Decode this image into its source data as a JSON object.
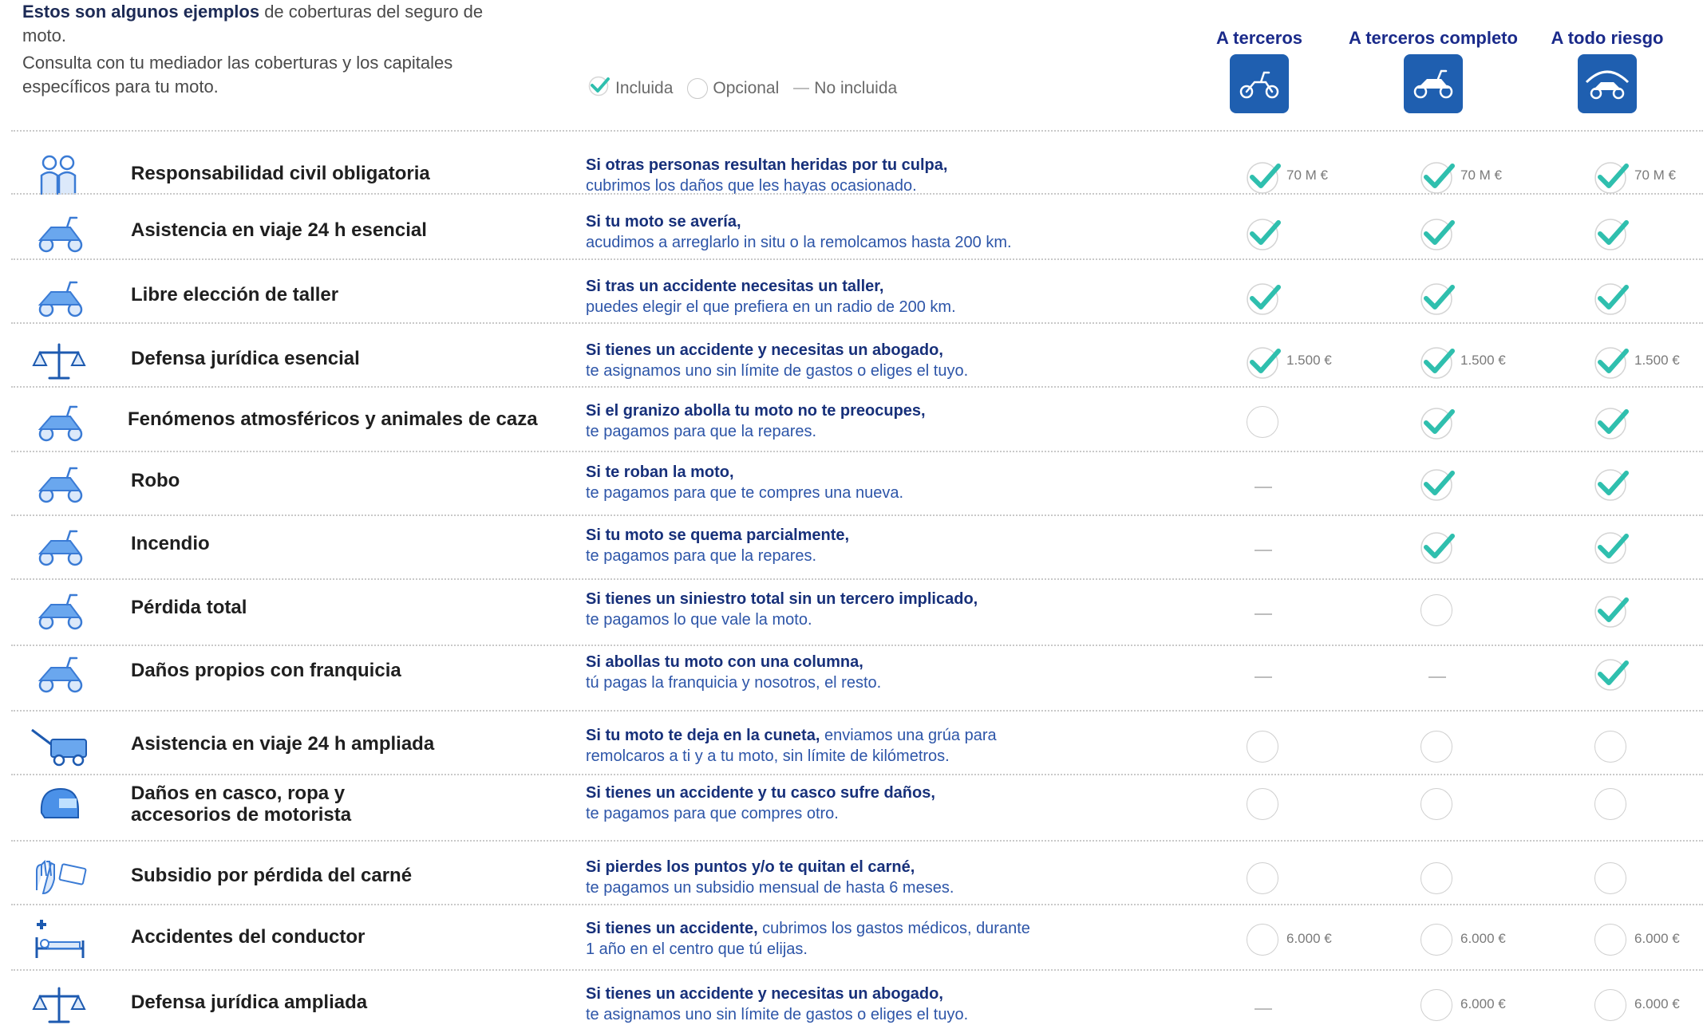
{
  "intro": {
    "bold": "Estos son algunos ejemplos",
    "rest": " de coberturas del seguro de moto.",
    "line2": "Consulta con tu mediador las coberturas y los capitales específicos para tu moto."
  },
  "legend": {
    "included": "Incluida",
    "optional": "Opcional",
    "not_included": "No incluida"
  },
  "plans": [
    {
      "name": "A terceros",
      "icon": "scooter-outline-icon"
    },
    {
      "name": "A terceros completo",
      "icon": "scooter-filled-icon"
    },
    {
      "name": "A todo riesgo",
      "icon": "scooter-umbrella-icon"
    }
  ],
  "colors": {
    "included_check": "#2fbfae",
    "title": "#1a2a8a",
    "desc": "#2d55a8",
    "plan_icon_bg": "#1f5fb0"
  },
  "rows": [
    {
      "title": "Responsabilidad civil obligatoria",
      "icon": "people-icon",
      "desc_bold": "Si otras personas resultan heridas por tu culpa,",
      "desc": "cubrimos los daños que les hayas ocasionado.",
      "cells": [
        {
          "s": "included",
          "v": "70 M €"
        },
        {
          "s": "included",
          "v": "70 M €"
        },
        {
          "s": "included",
          "v": "70 M €"
        }
      ]
    },
    {
      "title": "Asistencia en viaje 24 h esencial",
      "icon": "wrench-scooter-icon",
      "desc_bold": "Si tu moto se avería,",
      "desc": "acudimos a arreglarlo in situ o la remolcamos hasta 200 km.",
      "cells": [
        {
          "s": "included",
          "v": ""
        },
        {
          "s": "included",
          "v": ""
        },
        {
          "s": "included",
          "v": ""
        }
      ]
    },
    {
      "title": "Libre elección de taller",
      "icon": "scooter-wrench-icon",
      "desc_bold": "Si tras un accidente necesitas un taller,",
      "desc": "puedes elegir el que prefiera en un radio de 200 km.",
      "cells": [
        {
          "s": "included",
          "v": ""
        },
        {
          "s": "included",
          "v": ""
        },
        {
          "s": "included",
          "v": ""
        }
      ]
    },
    {
      "title": "Defensa jurídica esencial",
      "icon": "scales-icon",
      "desc_bold": "Si tienes un accidente y necesitas un abogado,",
      "desc": "te asignamos uno sin límite de gastos o eliges el tuyo.",
      "cells": [
        {
          "s": "included",
          "v": "1.500 €"
        },
        {
          "s": "included",
          "v": "1.500 €"
        },
        {
          "s": "included",
          "v": "1.500 €"
        }
      ]
    },
    {
      "title": "Fenómenos atmosféricos y animales de caza",
      "icon": "hail-scooter-icon",
      "desc_bold": "Si el granizo abolla tu moto no te preocupes,",
      "desc": "te pagamos para que la repares.",
      "cells": [
        {
          "s": "optional",
          "v": ""
        },
        {
          "s": "included",
          "v": ""
        },
        {
          "s": "included",
          "v": ""
        }
      ]
    },
    {
      "title": "Robo",
      "icon": "thief-scooter-icon",
      "desc_bold": "Si te roban la moto,",
      "desc": "te pagamos para que te compres una nueva.",
      "cells": [
        {
          "s": "none",
          "v": ""
        },
        {
          "s": "included",
          "v": ""
        },
        {
          "s": "included",
          "v": ""
        }
      ]
    },
    {
      "title": "Incendio",
      "icon": "fire-scooter-icon",
      "desc_bold": "Si tu moto se quema parcialmente,",
      "desc": "te pagamos para que la repares.",
      "cells": [
        {
          "s": "none",
          "v": ""
        },
        {
          "s": "included",
          "v": ""
        },
        {
          "s": "included",
          "v": ""
        }
      ]
    },
    {
      "title": "Pérdida total",
      "icon": "tree-scooter-icon",
      "desc_bold": "Si tienes un siniestro total sin un tercero implicado,",
      "desc": "te pagamos lo que vale la moto.",
      "cells": [
        {
          "s": "none",
          "v": ""
        },
        {
          "s": "optional",
          "v": ""
        },
        {
          "s": "included",
          "v": ""
        }
      ]
    },
    {
      "title": "Daños propios con franquicia",
      "icon": "parking-scooter-icon",
      "desc_bold": "Si abollas tu moto con una columna,",
      "desc": "tú pagas la franquicia y nosotros, el resto.",
      "cells": [
        {
          "s": "none",
          "v": ""
        },
        {
          "s": "none",
          "v": ""
        },
        {
          "s": "included",
          "v": ""
        }
      ]
    },
    {
      "title": "Asistencia en viaje 24 h ampliada",
      "icon": "tow-truck-icon",
      "desc_bold": "Si tu moto te deja en la cuneta,",
      "desc": " enviamos una grúa para remolcaros a ti y a tu moto, sin límite de kilómetros.",
      "cells": [
        {
          "s": "optional",
          "v": ""
        },
        {
          "s": "optional",
          "v": ""
        },
        {
          "s": "optional",
          "v": ""
        }
      ]
    },
    {
      "title": "Daños en casco, ropa y accesorios de motorista",
      "icon": "helmet-icon",
      "desc_bold": "Si tienes un accidente y tu casco sufre daños,",
      "desc": "te pagamos para que compres otro.",
      "cells": [
        {
          "s": "optional",
          "v": ""
        },
        {
          "s": "optional",
          "v": ""
        },
        {
          "s": "optional",
          "v": ""
        }
      ]
    },
    {
      "title": "Subsidio por pérdida del carné",
      "icon": "hand-license-icon",
      "desc_bold": "Si pierdes los puntos y/o te quitan el carné,",
      "desc": "te pagamos un subsidio mensual de hasta 6 meses.",
      "cells": [
        {
          "s": "optional",
          "v": ""
        },
        {
          "s": "optional",
          "v": ""
        },
        {
          "s": "optional",
          "v": ""
        }
      ]
    },
    {
      "title": "Accidentes del conductor",
      "icon": "hospital-bed-icon",
      "desc_bold": "Si tienes un accidente,",
      "desc": " cubrimos los gastos médicos, durante 1 año en el centro que tú elijas.",
      "cells": [
        {
          "s": "optional",
          "v": "6.000 €"
        },
        {
          "s": "optional",
          "v": "6.000 €"
        },
        {
          "s": "optional",
          "v": "6.000 €"
        }
      ]
    },
    {
      "title": "Defensa jurídica ampliada",
      "icon": "scales-icon",
      "desc_bold": "Si tienes un accidente y necesitas un abogado,",
      "desc": "te asignamos uno sin límite de gastos o eliges el tuyo.",
      "cells": [
        {
          "s": "none",
          "v": ""
        },
        {
          "s": "optional",
          "v": "6.000 €"
        },
        {
          "s": "optional",
          "v": "6.000 €"
        }
      ]
    }
  ]
}
